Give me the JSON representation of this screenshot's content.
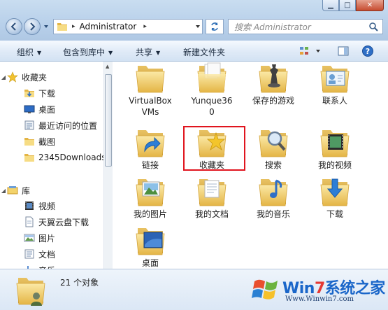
{
  "window": {
    "minimize": "▁",
    "maximize": "□",
    "close": "✕"
  },
  "address": {
    "crumb": "Administrator",
    "separator": "▸"
  },
  "search": {
    "placeholder": "搜索 Administrator"
  },
  "toolbar": {
    "organize": "组织",
    "include_in_library": "包含到库中",
    "share": "共享",
    "new_folder": "新建文件夹",
    "caret": "▼"
  },
  "nav": {
    "favorites": "收藏夹",
    "favorites_items": [
      "下载",
      "桌面",
      "最近访问的位置",
      "截图",
      "2345Downloads"
    ],
    "libraries": "库",
    "libraries_items": [
      "视频",
      "天翼云盘下载",
      "图片",
      "文档",
      "音乐"
    ]
  },
  "content": {
    "items": [
      "VirtualBox VMs",
      "Yunque360",
      "保存的游戏",
      "联系人",
      "链接",
      "收藏夹",
      "搜索",
      "我的视频",
      "我的图片",
      "我的文档",
      "我的音乐",
      "下载",
      "桌面"
    ],
    "labels_display": {
      "vbox_line1": "VirtualBox",
      "vbox_line2": "VMs",
      "yunque_line1": "Yunque36",
      "yunque_line2": "0"
    }
  },
  "details": {
    "count": "21 个对象"
  },
  "watermark": {
    "brand_prefix": "Win",
    "brand_seven": "7",
    "brand_suffix": "系统之家",
    "url": "Www.Winwin7.com"
  },
  "colors": {
    "highlight": "#e0141e",
    "folder": "#f0c95a",
    "brand_blue": "#1a66c9"
  }
}
